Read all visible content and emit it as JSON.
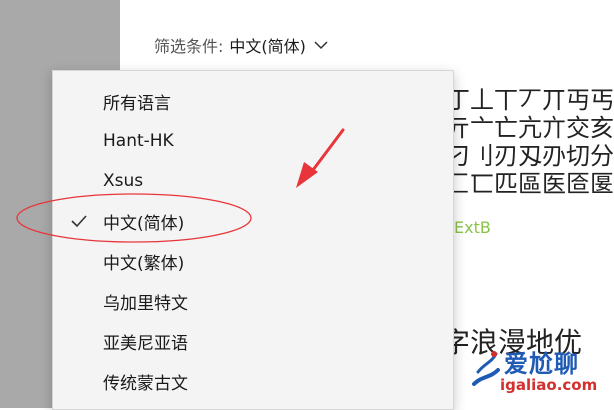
{
  "filter": {
    "label": "筛选条件:",
    "value": "中文(简体)"
  },
  "dropdown": {
    "items": [
      {
        "label": "所有语言",
        "selected": false
      },
      {
        "label": "Hant-HK",
        "selected": false
      },
      {
        "label": "Xsus",
        "selected": false
      },
      {
        "label": "中文(简体)",
        "selected": true
      },
      {
        "label": "中文(繁体)",
        "selected": false
      },
      {
        "label": "乌加里特文",
        "selected": false
      },
      {
        "label": "亚美尼亚语",
        "selected": false
      },
      {
        "label": "传统蒙古文",
        "selected": false
      }
    ]
  },
  "background": {
    "glyph_rows": [
      "丁丄丅丆丌丏丐丑",
      "亓亠亡亢亣交亥亦",
      "刁刂刃刄刅切分刈",
      "匚匸匹區医匼匽匾"
    ],
    "ext_label": "ExtB",
    "bottom_text": "字浪漫地优"
  },
  "watermark": {
    "title": "爱尬聊",
    "url": "igaliao.com"
  },
  "colors": {
    "annotation_red": "#e8353a",
    "accent_green": "#8bc34a"
  },
  "icons": {
    "filter_chevron": "chevron-down-icon",
    "selected_check": "check-icon"
  }
}
